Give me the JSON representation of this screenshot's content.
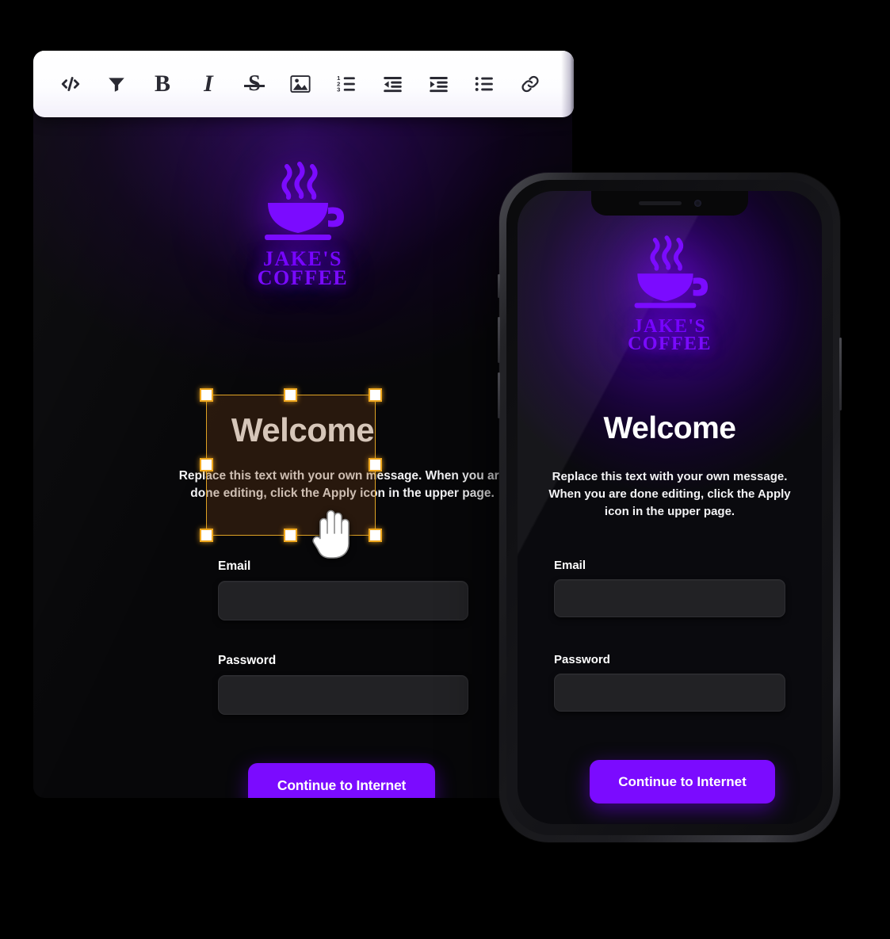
{
  "toolbar": {
    "name": "rich-text-editor-toolbar",
    "buttons": [
      {
        "id": "code",
        "icon": "code-icon",
        "label": "Code"
      },
      {
        "id": "filter",
        "icon": "filter-icon",
        "label": "Filter"
      },
      {
        "id": "bold",
        "icon": "bold-icon",
        "label": "B"
      },
      {
        "id": "italic",
        "icon": "italic-icon",
        "label": "I"
      },
      {
        "id": "strikethrough",
        "icon": "strikethrough-icon",
        "label": "S"
      },
      {
        "id": "image",
        "icon": "image-icon",
        "label": "Image"
      },
      {
        "id": "numbered-list",
        "icon": "numbered-list-icon",
        "label": "Numbered list"
      },
      {
        "id": "outdent",
        "icon": "outdent-icon",
        "label": "Decrease indent"
      },
      {
        "id": "indent",
        "icon": "indent-icon",
        "label": "Increase indent"
      },
      {
        "id": "bullet-list",
        "icon": "bullet-list-icon",
        "label": "Bulleted list"
      },
      {
        "id": "link",
        "icon": "link-icon",
        "label": "Link"
      }
    ]
  },
  "desktop": {
    "logo": {
      "line1": "JAKE'S",
      "line2": "COFFEE",
      "icon": "coffee-cup-icon"
    },
    "title": "Welcome",
    "body": "Replace this text with your own message. When you are done editing, click the Apply icon in the upper page.",
    "email_label": "Email",
    "email_value": "",
    "email_placeholder": "",
    "password_label": "Password",
    "password_value": "",
    "password_placeholder": "",
    "cta_label": "Continue to Internet",
    "selection": {
      "visible": true,
      "handle_count": 8,
      "cursor": "grab-hand-cursor"
    }
  },
  "phone": {
    "logo": {
      "line1": "JAKE'S",
      "line2": "COFFEE",
      "icon": "coffee-cup-icon"
    },
    "title": "Welcome",
    "body": "Replace this text with your own message. When you are done editing, click the Apply icon in the upper page.",
    "email_label": "Email",
    "email_value": "",
    "email_placeholder": "",
    "password_label": "Password",
    "password_value": "",
    "password_placeholder": "",
    "cta_label": "Continue to Internet"
  },
  "colors": {
    "accent_purple": "#7b0bff",
    "selection_orange": "#f0a81e",
    "page_background": "#000000",
    "toolbar_background": "#ffffff",
    "input_background": "#222225",
    "text_primary": "#ffffff"
  }
}
